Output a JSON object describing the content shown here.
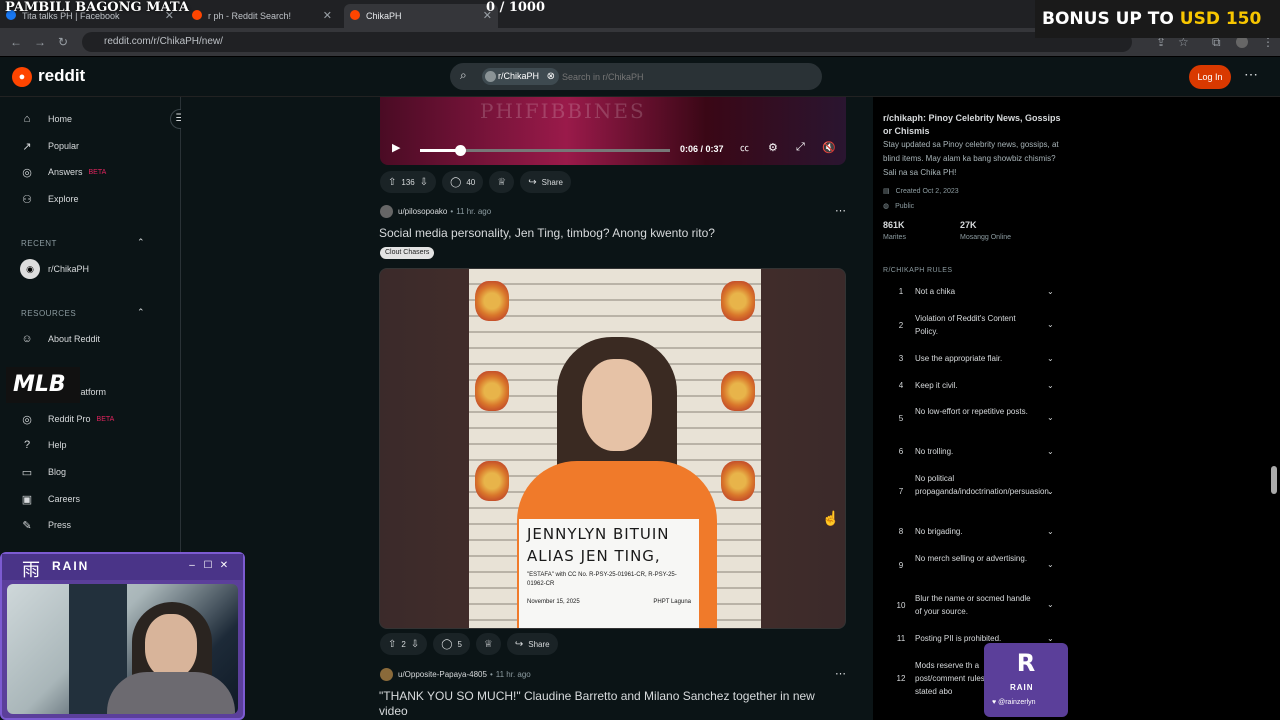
{
  "overlay": {
    "title": "PAMBILI BAGONG MATA",
    "counter": "0   / 1000",
    "bonus_prefix": "BONUS UP TO ",
    "bonus_value": "USD 150",
    "mlb_logo": "MLB"
  },
  "browser": {
    "tabs": [
      {
        "label": "Tita talks PH | Facebook",
        "active": false
      },
      {
        "label": "r ph - Reddit Search!",
        "active": false
      },
      {
        "label": "ChikaPH",
        "active": true
      }
    ],
    "url": "reddit.com/r/ChikaPH/new/"
  },
  "header": {
    "logo_text": "reddit",
    "search_chip": "r/ChikaPH",
    "search_placeholder": "Search in r/ChikaPH",
    "login_label": "Log In"
  },
  "sidebar": {
    "nav": [
      {
        "label": "Home",
        "icon": "home-icon",
        "glyph": "⌂"
      },
      {
        "label": "Popular",
        "icon": "popular-icon",
        "glyph": "↗"
      },
      {
        "label": "Answers",
        "icon": "answers-icon",
        "glyph": "◎",
        "badge": "BETA"
      },
      {
        "label": "Explore",
        "icon": "explore-icon",
        "glyph": "⚇"
      }
    ],
    "recent_heading": "RECENT",
    "recent_items": [
      {
        "label": "r/ChikaPH"
      }
    ],
    "resources_heading": "RESOURCES",
    "resources": [
      {
        "label": "About Reddit",
        "glyph": "☺"
      },
      {
        "label": "er Platform",
        "glyph": ""
      },
      {
        "label": "Reddit Pro",
        "glyph": "◎",
        "badge": "BETA"
      },
      {
        "label": "Help",
        "glyph": "?"
      },
      {
        "label": "Blog",
        "glyph": "▭"
      },
      {
        "label": "Careers",
        "glyph": "▣"
      },
      {
        "label": "Press",
        "glyph": "✎"
      }
    ]
  },
  "video": {
    "watermark": "PHIFIBBINES",
    "time": "0:06 / 0:37",
    "progress": 0.16
  },
  "posts": [
    {
      "upvotes": "136",
      "comments": "40",
      "share": "Share"
    },
    {
      "user": "u/pilosopoako",
      "time": "11 hr. ago",
      "title": "Social media personality, Jen Ting, timbog? Anong kwento rito?",
      "flair": "Clout Chasers",
      "image": {
        "placard_line1": "JENNYLYN    BITUIN",
        "placard_line2": "ALIAS JEN TING,",
        "placard_case": "\"ESTAFA\" with CC No. R-PSY-25-01961-CR, R-PSY-25-01962-CR",
        "placard_date": "November 15, 2025",
        "placard_station": "PHPT Laguna"
      },
      "upvotes": "2",
      "comments": "5",
      "share": "Share"
    },
    {
      "user": "u/Opposite-Papaya-4805",
      "time": "11 hr. ago",
      "title": "\"THANK YOU SO MUCH!\" Claudine Barretto and Milano Sanchez together in new video"
    }
  ],
  "community": {
    "title": "r/chikaph: Pinoy Celebrity News, Gossips or Chismis",
    "description": "Stay updated sa Pinoy celebrity news, gossips, at blind items. May alam ka bang showbiz chismis? Sali na sa Chika PH!",
    "created": "Created Oct 2, 2023",
    "visibility": "Public",
    "members_count": "861K",
    "members_label": "Marites",
    "online_count": "27K",
    "online_label": "Mosangg Online",
    "rules_heading": "R/CHIKAPH RULES",
    "rules": [
      {
        "n": "1",
        "text": "Not a chika"
      },
      {
        "n": "2",
        "text": "Violation of Reddit's Content Policy."
      },
      {
        "n": "3",
        "text": "Use the appropriate flair."
      },
      {
        "n": "4",
        "text": "Keep it civil."
      },
      {
        "n": "5",
        "text": "No low-effort or repetitive posts."
      },
      {
        "n": "6",
        "text": "No trolling."
      },
      {
        "n": "7",
        "text": "No political propaganda/indoctrination/persuasion."
      },
      {
        "n": "8",
        "text": "No brigading."
      },
      {
        "n": "9",
        "text": "No merch selling or advertising."
      },
      {
        "n": "10",
        "text": "Blur the name or socmed handle of your source."
      },
      {
        "n": "11",
        "text": "Posting PII is prohibited."
      },
      {
        "n": "12",
        "text": "Mods reserve th a post/comment rules stated abo"
      }
    ]
  },
  "stream": {
    "cam_brand_glyph": "雨",
    "cam_brand_text": "RAIN",
    "badge_text": "RAIN",
    "badge_handle": "@rainzerlyn"
  },
  "colors": {
    "reddit_orange": "#ff4500",
    "login_bg": "#d93900",
    "rain_purple": "#5b3f9a",
    "beta_pink": "#e0245e",
    "bonus_yellow": "#f7c600"
  }
}
